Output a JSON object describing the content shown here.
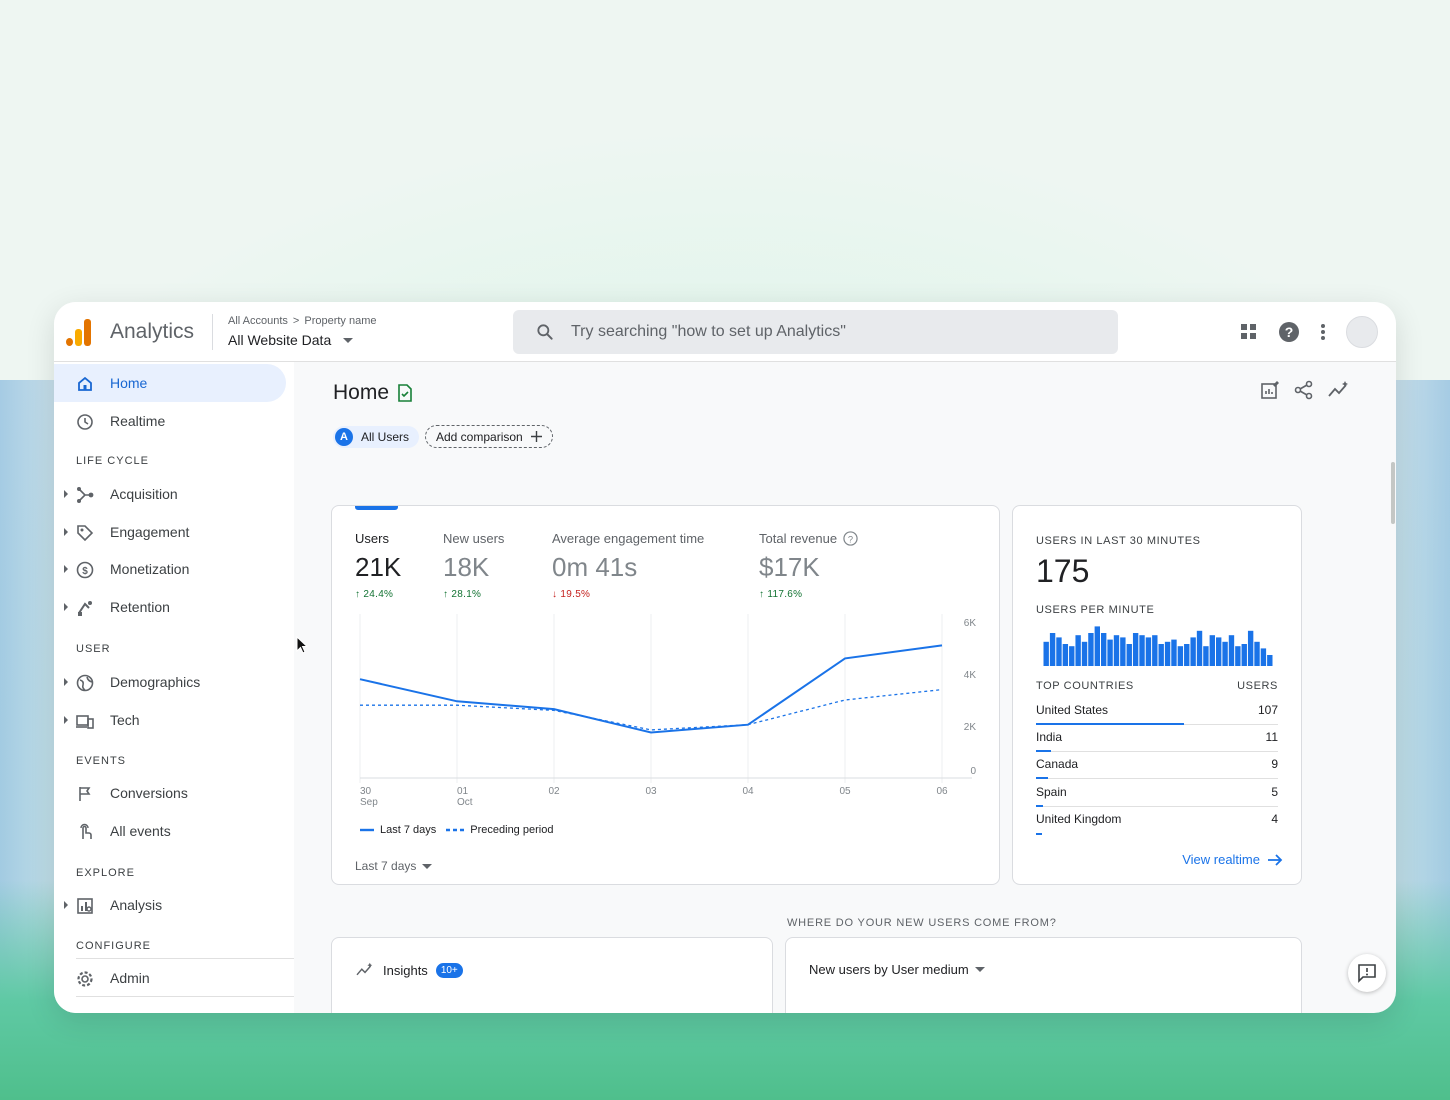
{
  "colors": {
    "accent": "#1a73e8",
    "up": "#137333",
    "down": "#c5221f"
  },
  "header": {
    "app_name": "Analytics",
    "breadcrumb": [
      "All Accounts",
      "Property name"
    ],
    "property": "All Website Data",
    "search_placeholder": "Try searching \"how to set up Analytics\"",
    "icons": [
      "apps-grid-icon",
      "help-icon",
      "more-vert-icon",
      "account-avatar"
    ]
  },
  "sidebar": {
    "top_items": [
      {
        "label": "Home",
        "icon": "home-icon",
        "active": true
      },
      {
        "label": "Realtime",
        "icon": "clock-icon"
      }
    ],
    "sections": [
      {
        "title": "LIFE CYCLE",
        "items": [
          {
            "label": "Acquisition",
            "icon": "acquisition-icon"
          },
          {
            "label": "Engagement",
            "icon": "tag-icon"
          },
          {
            "label": "Monetization",
            "icon": "dollar-icon"
          },
          {
            "label": "Retention",
            "icon": "retention-icon"
          }
        ]
      },
      {
        "title": "USER",
        "items": [
          {
            "label": "Demographics",
            "icon": "globe-icon"
          },
          {
            "label": "Tech",
            "icon": "devices-icon"
          }
        ]
      },
      {
        "title": "EVENTS",
        "items": [
          {
            "label": "Conversions",
            "icon": "flag-icon"
          },
          {
            "label": "All events",
            "icon": "touch-icon"
          }
        ]
      },
      {
        "title": "EXPLORE",
        "items": [
          {
            "label": "Analysis",
            "icon": "analysis-icon"
          }
        ]
      },
      {
        "title": "CONFIGURE",
        "items": [
          {
            "label": "Admin",
            "icon": "gear-icon"
          }
        ]
      }
    ]
  },
  "main": {
    "title": "Home",
    "chip_all_users_letter": "A",
    "chip_all_users": "All Users",
    "add_comparison": "Add comparison",
    "metrics": [
      {
        "label": "Users",
        "value": "21K",
        "delta": "24.4%",
        "dir": "up"
      },
      {
        "label": "New users",
        "value": "18K",
        "delta": "28.1%",
        "dir": "up"
      },
      {
        "label": "Average engagement time",
        "value": "0m 41s",
        "delta": "19.5%",
        "dir": "down"
      },
      {
        "label": "Total revenue",
        "value": "$17K",
        "delta": "117.6%",
        "dir": "up"
      }
    ],
    "legend_current": "Last 7 days",
    "legend_previous": "Preceding period",
    "date_range": "Last 7 days"
  },
  "chart_data": {
    "type": "line",
    "x": [
      "30 Sep",
      "01 Oct",
      "02",
      "03",
      "04",
      "05",
      "06"
    ],
    "x_tick_top": [
      "30",
      "01",
      "02",
      "03",
      "04",
      "05",
      "06"
    ],
    "x_tick_bottom": [
      "Sep",
      "Oct",
      "",
      "",
      "",
      "",
      ""
    ],
    "y_ticks": [
      "6K",
      "4K",
      "2K",
      "0"
    ],
    "ylim": [
      0,
      6000
    ],
    "series": [
      {
        "name": "Last 7 days",
        "style": "solid",
        "values": [
          3800,
          2950,
          2650,
          1750,
          2050,
          4600,
          5100
        ]
      },
      {
        "name": "Preceding period",
        "style": "dashed",
        "values": [
          2800,
          2800,
          2600,
          1850,
          2050,
          3000,
          3400
        ]
      }
    ]
  },
  "realtime": {
    "title": "USERS IN LAST 30 MINUTES",
    "count": "175",
    "per_minute_label": "USERS PER MINUTE",
    "per_minute_values": [
      22,
      30,
      26,
      20,
      18,
      28,
      22,
      30,
      36,
      30,
      24,
      28,
      26,
      20,
      30,
      28,
      26,
      28,
      20,
      22,
      24,
      18,
      20,
      26,
      32,
      18,
      28,
      26,
      22,
      28,
      18,
      20,
      32,
      22,
      16,
      10
    ],
    "top_countries_label": "TOP COUNTRIES",
    "users_label": "USERS",
    "countries": [
      {
        "name": "United States",
        "users": "107",
        "share": 1.0
      },
      {
        "name": "India",
        "users": "11",
        "share": 0.1
      },
      {
        "name": "Canada",
        "users": "9",
        "share": 0.08
      },
      {
        "name": "Spain",
        "users": "5",
        "share": 0.05
      },
      {
        "name": "United Kingdom",
        "users": "4",
        "share": 0.04
      }
    ],
    "view_link": "View realtime"
  },
  "bottom": {
    "where_title": "WHERE DO YOUR NEW USERS COME FROM?",
    "insights_label": "Insights",
    "insights_badge": "10+",
    "new_users_by": "New users by User medium"
  }
}
